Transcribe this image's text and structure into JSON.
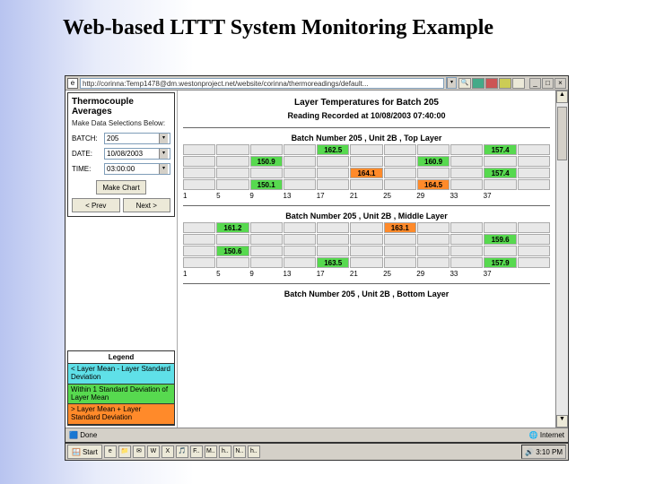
{
  "slide_title": "Web-based LTTT System Monitoring Example",
  "addr": "http://corinna:Temp1478@dm.westonproject.net/website/corinna/thermoreadings/default...",
  "sidebar": {
    "title": "Thermocouple Averages",
    "subtitle": "Make Data Selections Below:",
    "batch_label": "BATCH:",
    "batch_value": "205",
    "date_label": "DATE:",
    "date_value": "10/08/2003",
    "time_label": "TIME:",
    "time_value": "03:00:00",
    "make_chart": "Make Chart",
    "prev": "< Prev",
    "next": "Next >"
  },
  "legend": {
    "title": "Legend",
    "row1": "< Layer Mean - Layer Standard Deviation",
    "row2": "Within 1 Standard Deviation of Layer Mean",
    "row3": "> Layer Mean + Layer Standard Deviation"
  },
  "main": {
    "title": "Layer Temperatures for Batch 205",
    "subtitle": "Reading Recorded at 10/08/2003 07:40:00",
    "axis": [
      "1",
      "5",
      "9",
      "13",
      "17",
      "21",
      "25",
      "29",
      "33",
      "37",
      ""
    ],
    "chart1": {
      "title": "Batch Number 205 , Unit 2B , Top Layer",
      "rows": [
        [
          null,
          null,
          null,
          null,
          "162.5",
          null,
          null,
          null,
          null,
          "157.4",
          null
        ],
        [
          null,
          null,
          "150.9",
          null,
          null,
          null,
          null,
          "160.9",
          null,
          null,
          null
        ],
        [
          null,
          null,
          null,
          null,
          null,
          "164.1",
          null,
          null,
          null,
          "157.4",
          null
        ],
        [
          null,
          null,
          "150.1",
          null,
          null,
          null,
          null,
          "164.5",
          null,
          null,
          null
        ]
      ],
      "classes": [
        [
          null,
          null,
          null,
          null,
          "v",
          null,
          null,
          null,
          null,
          "v",
          null
        ],
        [
          null,
          null,
          "v",
          null,
          null,
          null,
          null,
          "v",
          null,
          null,
          null
        ],
        [
          null,
          null,
          null,
          null,
          null,
          "o",
          null,
          null,
          null,
          "v",
          null
        ],
        [
          null,
          null,
          "v",
          null,
          null,
          null,
          null,
          "o",
          null,
          null,
          null
        ]
      ]
    },
    "chart2": {
      "title": "Batch Number 205 , Unit 2B , Middle Layer",
      "rows": [
        [
          null,
          "161.2",
          null,
          null,
          null,
          null,
          "163.1",
          null,
          null,
          null,
          null
        ],
        [
          null,
          null,
          null,
          null,
          null,
          null,
          null,
          null,
          null,
          "159.6",
          null
        ],
        [
          null,
          "150.6",
          null,
          null,
          null,
          null,
          null,
          null,
          null,
          null,
          null
        ],
        [
          null,
          null,
          null,
          null,
          "163.5",
          null,
          null,
          null,
          null,
          "157.9",
          null
        ]
      ],
      "classes": [
        [
          null,
          "v",
          null,
          null,
          null,
          null,
          "o",
          null,
          null,
          null,
          null
        ],
        [
          null,
          null,
          null,
          null,
          null,
          null,
          null,
          null,
          null,
          "v",
          null
        ],
        [
          null,
          "v",
          null,
          null,
          null,
          null,
          null,
          null,
          null,
          null,
          null
        ],
        [
          null,
          null,
          null,
          null,
          "v",
          null,
          null,
          null,
          null,
          "v",
          null
        ]
      ]
    },
    "chart3": {
      "title": "Batch Number 205 , Unit 2B , Bottom Layer"
    }
  },
  "status": {
    "left": "Done",
    "right": "Internet"
  },
  "taskbar": {
    "start": "Start",
    "time": "3:10 PM"
  },
  "chart_data": [
    {
      "type": "heatmap",
      "title": "Batch Number 205, Unit 2B, Top Layer",
      "x": [
        1,
        5,
        9,
        13,
        17,
        21,
        25,
        29,
        33,
        37
      ],
      "rows": 4,
      "values": [
        {
          "row": 0,
          "col": 4,
          "val": 162.5
        },
        {
          "row": 0,
          "col": 8,
          "val": 157.4
        },
        {
          "row": 1,
          "col": 2,
          "val": 150.9
        },
        {
          "row": 1,
          "col": 6,
          "val": 160.9
        },
        {
          "row": 2,
          "col": 5,
          "val": 164.1
        },
        {
          "row": 2,
          "col": 8,
          "val": 157.4
        },
        {
          "row": 3,
          "col": 2,
          "val": 150.1
        },
        {
          "row": 3,
          "col": 6,
          "val": 164.5
        }
      ]
    },
    {
      "type": "heatmap",
      "title": "Batch Number 205, Unit 2B, Middle Layer",
      "x": [
        1,
        5,
        9,
        13,
        17,
        21,
        25,
        29,
        33,
        37
      ],
      "rows": 4,
      "values": [
        {
          "row": 0,
          "col": 1,
          "val": 161.2
        },
        {
          "row": 0,
          "col": 5,
          "val": 163.1
        },
        {
          "row": 1,
          "col": 8,
          "val": 159.6
        },
        {
          "row": 2,
          "col": 1,
          "val": 150.6
        },
        {
          "row": 3,
          "col": 4,
          "val": 163.5
        },
        {
          "row": 3,
          "col": 8,
          "val": 157.9
        }
      ]
    }
  ]
}
